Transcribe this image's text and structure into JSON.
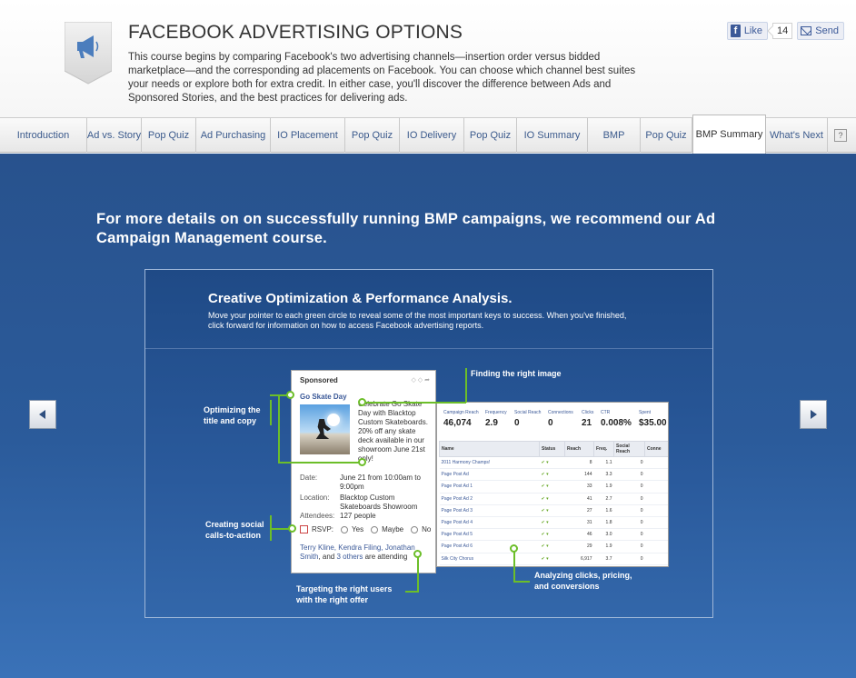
{
  "header": {
    "title": "FACEBOOK ADVERTISING OPTIONS",
    "description": "This course begins by comparing Facebook's two advertising channels—insertion order versus bidded marketplace—and the corresponding ad placements on Facebook. You can choose which channel best suites your needs or explore both for extra credit. In either case, you'll discover the difference between Ads and Sponsored Stories, and the best practices for delivering ads.",
    "like_label": "Like",
    "like_count": "14",
    "send_label": "Send",
    "badge_icon": "megaphone-icon"
  },
  "tabs": [
    {
      "label": "Introduction"
    },
    {
      "label": "Ad vs. Story"
    },
    {
      "label": "Pop Quiz"
    },
    {
      "label": "Ad Purchasing"
    },
    {
      "label": "IO Placement"
    },
    {
      "label": "Pop Quiz"
    },
    {
      "label": "IO Delivery"
    },
    {
      "label": "Pop Quiz"
    },
    {
      "label": "IO Summary"
    },
    {
      "label": "BMP"
    },
    {
      "label": "Pop Quiz"
    },
    {
      "label": "BMP Summary",
      "active": true
    },
    {
      "label": "What's Next"
    }
  ],
  "help_label": "?",
  "stage": {
    "headline": "For more details on on successfully running BMP campaigns, we recommend our Ad Campaign Management course.",
    "prev_icon": "triangle-left-icon",
    "next_icon": "triangle-right-icon"
  },
  "panel": {
    "title": "Creative Optimization & Performance Analysis.",
    "subtitle": "Move your pointer to each green circle to reveal some of the most important keys to success. When you've finished, click forward for information on how to access Facebook advertising reports.",
    "callouts": {
      "image": "Finding the right image",
      "title_copy_1": "Optimizing the",
      "title_copy_2": "title and copy",
      "social_1": "Creating social",
      "social_2": "calls-to-action",
      "users_1": "Targeting the right users",
      "users_2": "with the right offer",
      "clicks_1": "Analyzing clicks, pricing,",
      "clicks_2": "and conversions"
    },
    "card": {
      "header": "Sponsored",
      "event_title": "Go Skate Day",
      "event_text": "Celebrate Go Skate Day with Blacktop Custom Skateboards. 20% off any skate deck available in our showroom June 21st only!",
      "date_label": "Date:",
      "date_value": "June 21 from 10:00am to 9:00pm",
      "location_label": "Location:",
      "location_value": "Blacktop Custom Skateboards Showroom",
      "attendees_label": "Attendees:",
      "attendees_value": "127 people",
      "rsvp_label": "RSVP:",
      "rsvp_yes": "Yes",
      "rsvp_maybe": "Maybe",
      "rsvp_no": "No",
      "att_names": "Terry Kline, Kendra Filing, Jonathan Smith",
      "att_and": ", and ",
      "att_others": "3 others",
      "att_tail": " are attending"
    },
    "stats": {
      "metrics": [
        {
          "label": "Campaign Reach",
          "value": "46,074"
        },
        {
          "label": "Frequency",
          "value": "2.9"
        },
        {
          "label": "Social Reach",
          "value": "0"
        },
        {
          "label": "Connections",
          "value": "0"
        },
        {
          "label": "Clicks",
          "value": "21"
        },
        {
          "label": "CTR",
          "value": "0.008%"
        },
        {
          "label": "Spent",
          "value": "$35.00"
        }
      ],
      "columns": [
        "Name",
        "Status",
        "Reach",
        "Freq.",
        "Social Reach",
        "Conne"
      ],
      "rows": [
        [
          "2011 Harmony Champs!",
          "✔ ▾",
          "8",
          "1.1",
          "0"
        ],
        [
          "Page Post Ad",
          "✔ ▾",
          "144",
          "3.3",
          "0"
        ],
        [
          "Page Post Ad 1",
          "✔ ▾",
          "33",
          "1.9",
          "0"
        ],
        [
          "Page Post Ad 2",
          "✔ ▾",
          "41",
          "2.7",
          "0"
        ],
        [
          "Page Post Ad 3",
          "✔ ▾",
          "27",
          "1.6",
          "0"
        ],
        [
          "Page Post Ad 4",
          "✔ ▾",
          "31",
          "1.8",
          "0"
        ],
        [
          "Page Post Ad 5",
          "✔ ▾",
          "46",
          "3.0",
          "0"
        ],
        [
          "Page Post Ad 6",
          "✔ ▾",
          "29",
          "1.9",
          "0"
        ],
        [
          "Silk City Chorus",
          "✔ ▾",
          "6,917",
          "3.7",
          "0"
        ]
      ]
    }
  }
}
